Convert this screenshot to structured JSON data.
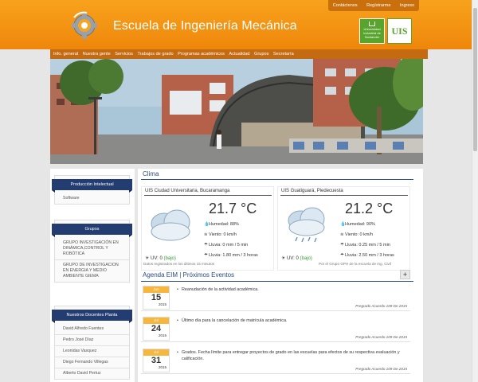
{
  "header": {
    "title": "Escuela de Ingeniería Mecánica",
    "top_links": [
      "Contáctenos",
      "Regístrarma",
      "Ingreso"
    ],
    "uis_text": "Universidad Industrial de Santander",
    "uis_logo": "UIS"
  },
  "nav": [
    "Info. general",
    "Nuestra gente",
    "Servicios",
    "Trabajos de grado",
    "Programas académicos",
    "Actualidad",
    "Grupos",
    "Secretaría"
  ],
  "sidebar": {
    "produccion": {
      "title": "Producción Intelectual",
      "items": [
        "Software"
      ]
    },
    "grupos": {
      "title": "Grupos",
      "items": [
        "GRUPO INVESTIGACIÓN EN DINÁMICA,CONTROL Y ROBÓTICA",
        "GRUPO DE INVESTIGACION EN ENERGIA Y MEDIO AMBIENTE GIEMA"
      ]
    },
    "docentes": {
      "title": "Nuestros Docentes Planta",
      "items": [
        "David Alfredo Fuentes",
        "Pedro José Díaz",
        "Leonidas Vasquez",
        "Diego Fernando Villegas",
        "Alberto David Pertuz"
      ]
    }
  },
  "clima": {
    "title": "Clima",
    "stations": [
      {
        "location": "UIS Ciudad Universitaria, Bucaramanga",
        "temp": "21.7 °C",
        "humidity": "Humedad: 88%",
        "wind": "Viento: 0 km/h",
        "rain_now": "Lluvia: 0 mm / 5 min",
        "rain_3h": "Lluvia: 1.80 mm / 3 horas",
        "uv": "UV: 0",
        "uv_level": "(bajo)"
      },
      {
        "location": "UIS Guatiguará, Piedecuesta",
        "temp": "21.2 °C",
        "humidity": "Humedad: 90%",
        "wind": "Viento: 0 km/h",
        "rain_now": "Lluvia: 0.25 mm / 5 min",
        "rain_3h": "Lluvia: 2.50 mm / 3 horas",
        "uv": "UV: 0",
        "uv_level": "(bajo)"
      }
    ],
    "note_left": "Datos registrados en los últimos 15 minutos",
    "note_right": "Por el Grupo GPH de la escuela de Ing. Civil"
  },
  "agenda": {
    "title": "Agenda EIM | Próximos Eventos",
    "plus": "+",
    "events": [
      {
        "month": "Jun",
        "day": "15",
        "year": "2015",
        "text": "Reanudación de la actividad académica.",
        "source": "Pregrado Acuerdo 109 De 2015"
      },
      {
        "month": "Jul",
        "day": "24",
        "year": "2015",
        "text": "Último día para la cancelación de matrícula académica.",
        "source": "Pregrado Acuerdo 109 De 2015"
      },
      {
        "month": "Jul",
        "day": "31",
        "year": "2015",
        "text": "Grados. Fecha límite para entregar proyectos de grado en las escuelas para efectos de su respectiva evaluación y calificación.",
        "source": "Pregrado Acuerdo 109 De 2015"
      }
    ]
  }
}
